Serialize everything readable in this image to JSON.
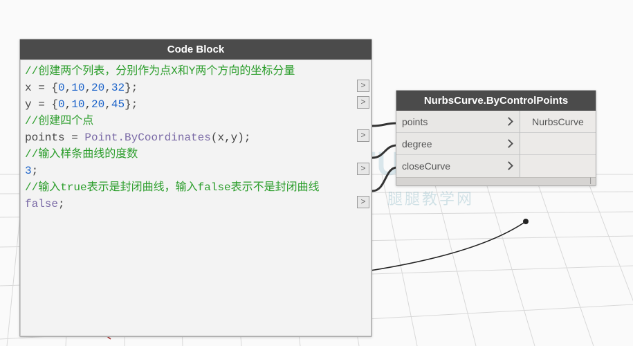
{
  "watermark": {
    "main": "TUITUISOFT",
    "sub": "腿腿教学网"
  },
  "codeBlock": {
    "title": "Code Block",
    "lines": {
      "c1": "//创建两个列表，分别作为点X和Y两个方向的坐标分量",
      "l2a": "x = {",
      "l2n1": "0",
      "l2s1": ",",
      "l2n2": "10",
      "l2s2": ",",
      "l2n3": "20",
      "l2s3": ",",
      "l2n4": "32",
      "l2e": "};",
      "l3a": "y = {",
      "l3n1": "0",
      "l3s1": ",",
      "l3n2": "10",
      "l3s2": ",",
      "l3n3": "20",
      "l3s3": ",",
      "l3n4": "45",
      "l3e": "};",
      "c2": "//创建四个点",
      "l5a": "points = ",
      "l5f": "Point.ByCoordinates",
      "l5b": "(x,y);",
      "c3": "//输入样条曲线的度数",
      "l7n": "3",
      "l7e": ";",
      "c4a": "//输入",
      "c4b": "true",
      "c4c": "表示是封闭曲线，输入fa",
      "c4d": "lse",
      "c4e": "表示不是封闭曲线",
      "l9k": "false",
      "l9e": ";"
    },
    "portGlyph": ">"
  },
  "nurbsNode": {
    "title": "NurbsCurve.ByControlPoints",
    "inputs": [
      "points",
      "degree",
      "closeCurve"
    ],
    "output": "NurbsCurve"
  }
}
